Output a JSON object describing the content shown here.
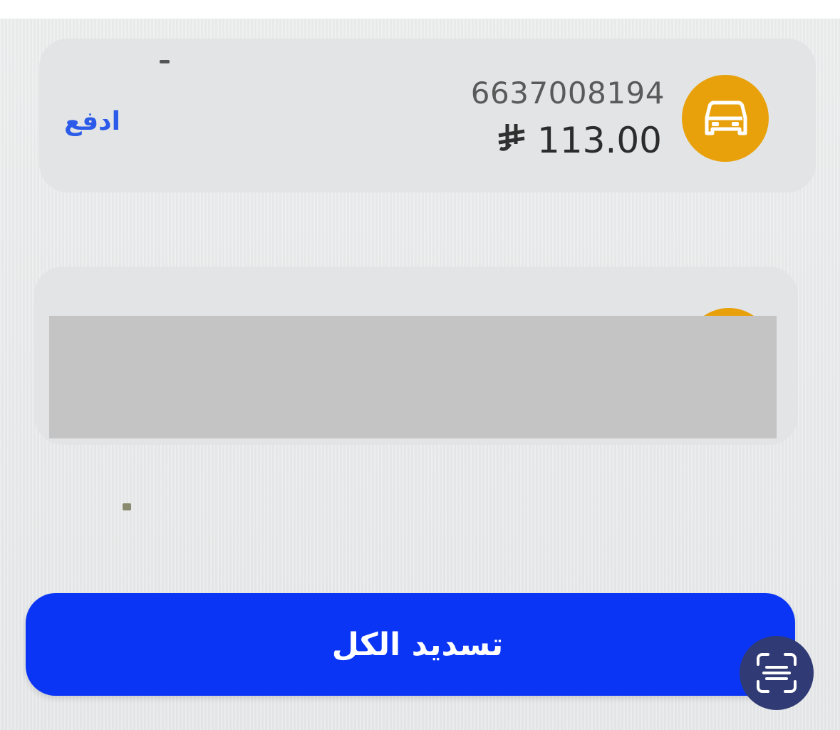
{
  "vehicles": [
    {
      "icon": "car-icon",
      "plate_number": "6637008194",
      "amount": "113.00",
      "currency_symbol": "⃁",
      "action_label": "ادفع"
    }
  ],
  "pay_all": {
    "label": "تسديد الكل"
  },
  "scan_button": {
    "icon": "text-scan-icon"
  },
  "colors": {
    "accent_blue": "#0a35f5",
    "link_blue": "#2b5be8",
    "badge_orange": "#e8a10b",
    "fab_navy": "#303a74"
  }
}
